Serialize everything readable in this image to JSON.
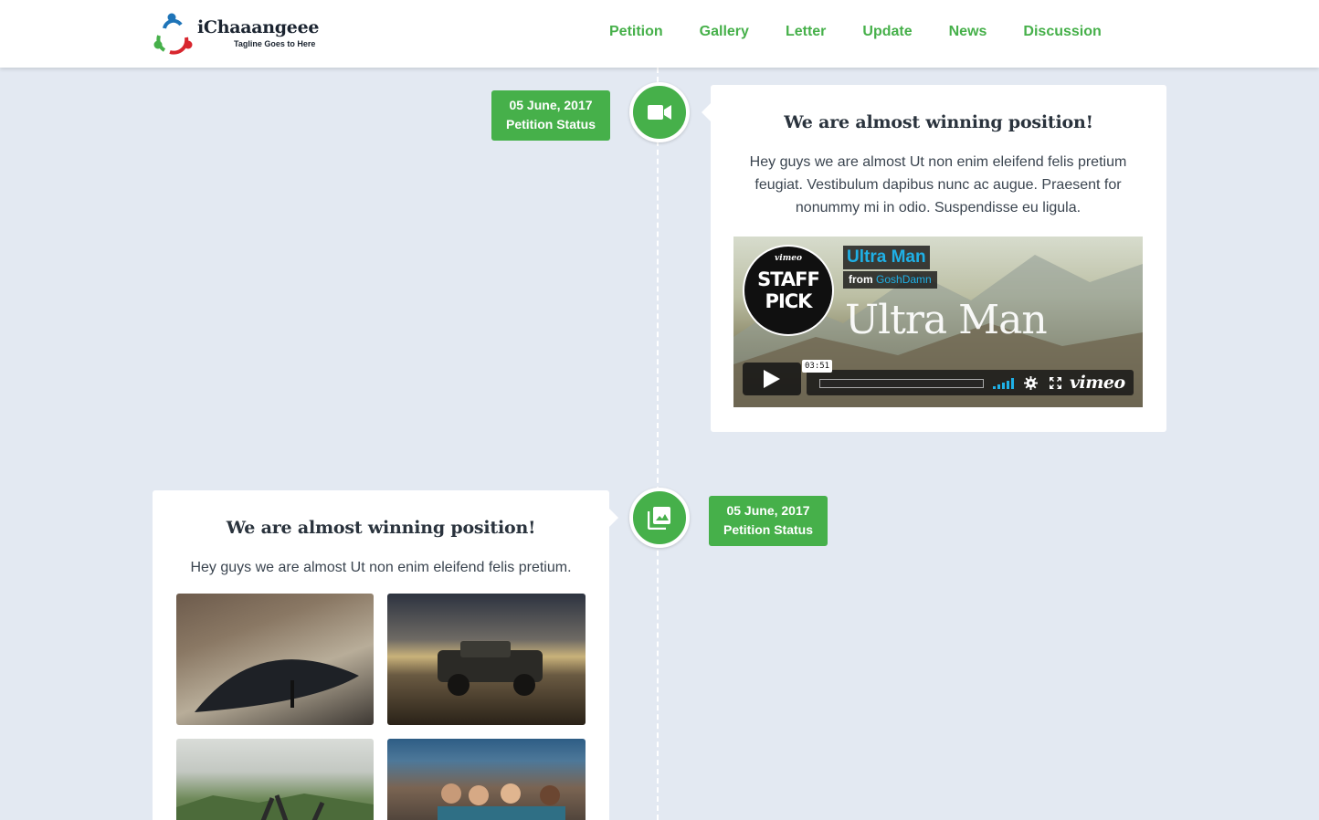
{
  "header": {
    "logo_title": "iChaaangeee",
    "logo_tagline": "Tagline Goes to Here",
    "nav": [
      "Petition",
      "Gallery",
      "Letter",
      "Update",
      "News",
      "Discussion"
    ]
  },
  "colors": {
    "accent": "#46b04a",
    "background": "#e3e9f2",
    "vimeo_blue": "#1fb0e6"
  },
  "timeline": [
    {
      "date": "05 June, 2017",
      "status": "Petition Status",
      "icon": "video-camera-icon",
      "title": "We are almost winning position!",
      "text": "Hey guys we are almost Ut non enim eleifend felis pretium feugiat. Vestibulum dapibus nunc ac augue. Praesent for nonummy mi in odio. Suspendisse eu ligula.",
      "video": {
        "badge_top": "vimeo",
        "badge_line1": "STAFF",
        "badge_line2": "PICK",
        "title": "Ultra Man",
        "from_label": "from",
        "author": "GoshDamn",
        "overlay_title": "Ultra Man",
        "duration": "03:51",
        "brand": "vimeo"
      }
    },
    {
      "date": "05 June, 2017",
      "status": "Petition Status",
      "icon": "photo-gallery-icon",
      "title": "We are almost winning position!",
      "text": "Hey guys we are almost Ut non enim eleifend felis pretium."
    }
  ]
}
